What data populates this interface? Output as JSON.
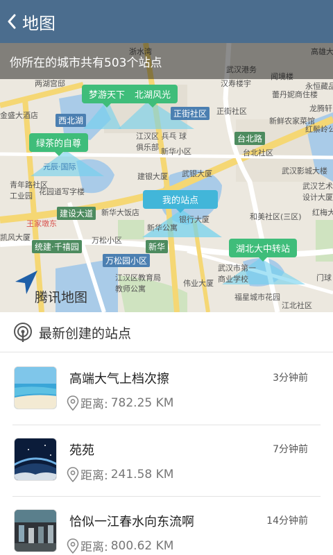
{
  "header": {
    "title": "地图"
  },
  "map": {
    "banner": "你所在的城市共有503个站点",
    "logo": "腾讯地图",
    "pins": [
      {
        "label": "梦游天下",
        "color": "green"
      },
      {
        "label": "北湖风光",
        "color": "green"
      },
      {
        "label": "绿茶的自尊",
        "color": "green"
      },
      {
        "label": "我的站点",
        "color": "blue"
      },
      {
        "label": "湖北大中转站",
        "color": "green"
      }
    ],
    "places": [
      "浙水湾",
      "高雄大厦",
      "武汉港务",
      "闻境楼",
      "两湖宫邸",
      "汉寿楼宇",
      "蕾丹妮商住楼",
      "龙腾轩",
      "永恒藏品",
      "金盛大酒店",
      "正街社区",
      "正街社区",
      "新鲜农家菜馆",
      "红鬃岭公",
      "江汉区 兵乓 球俱乐部",
      "新华小区",
      "台北社区",
      "元辰·国际",
      "建银大厦",
      "武银大厦",
      "武汉影城大楼",
      "青年路社区 工业园",
      "花园道写字楼",
      "武汉艺术 设计大厦",
      "王家墩东",
      "新华大饭店",
      "银行大厦",
      "和美社区(三区)",
      "红梅大",
      "凯风大厦",
      "万松小区",
      "新华公寓",
      "江汉区教育局 教师公寓",
      "武汉市第一 商业学校",
      "伟业大厦",
      "福星城市花园",
      "江北社区",
      "新华"
    ],
    "roads": [
      "西北湖",
      "台北路",
      "建设大道",
      "统建·千禧园",
      "万松园小区",
      "新华",
      "门球"
    ]
  },
  "section": {
    "title": "最新创建的站点"
  },
  "distance_label": "距离:",
  "stations": [
    {
      "title": "高端大气上档次擦",
      "time": "3分钟前",
      "distance": "782.25 KM",
      "thumb": "beach"
    },
    {
      "title": "苑苑",
      "time": "7分钟前",
      "distance": "241.58 KM",
      "thumb": "space"
    },
    {
      "title": "恰似一江春水向东流啊",
      "time": "14分钟前",
      "distance": "800.62 KM",
      "thumb": "crowd"
    }
  ],
  "icons": {
    "back": "chevron-left-icon",
    "locate": "navigation-arrow-icon",
    "section": "broadcast-icon",
    "distance": "location-pin-icon"
  }
}
